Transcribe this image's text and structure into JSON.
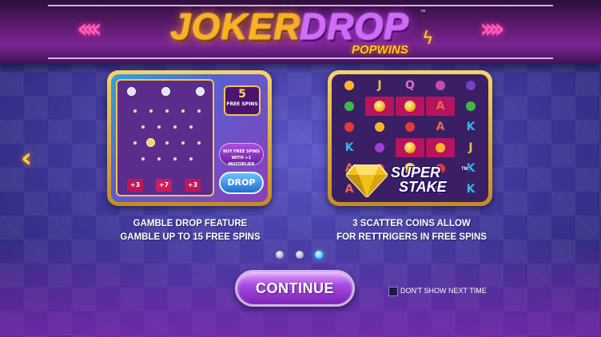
{
  "logo": {
    "word1": "JOKER",
    "word2": "DROP",
    "tm": "™",
    "sub": "POPWINS"
  },
  "nav": {
    "left_arrow": "‹"
  },
  "left_panel": {
    "free_spins_count": "5",
    "free_spins_label": "FREE SPINS",
    "buy_label": "BUY FREE SPINS WITH +1 MULTIPLIER",
    "drop_label": "DROP",
    "slots": [
      "+3",
      "+7",
      "+3"
    ],
    "caption_line1": "GAMBLE DROP FEATURE",
    "caption_line2": "GAMBLE UP TO 15 FREE SPINS"
  },
  "right_panel": {
    "super_line1": "SUPER",
    "super_line2": "STAKE",
    "super_tm": "TM",
    "caption_line1": "3 SCATTER COINS ALLOW",
    "caption_line2": "FOR RETTRIGERS IN FREE SPINS"
  },
  "pagination": {
    "count": 3,
    "active_index": 2
  },
  "continue_label": "CONTINUE",
  "dont_show_label": "DON'T SHOW NEXT TIME",
  "colors": {
    "accent_gold": "#f3c44f",
    "continue_purple": "#a64be0",
    "active_dot": "#2bd0ff"
  }
}
